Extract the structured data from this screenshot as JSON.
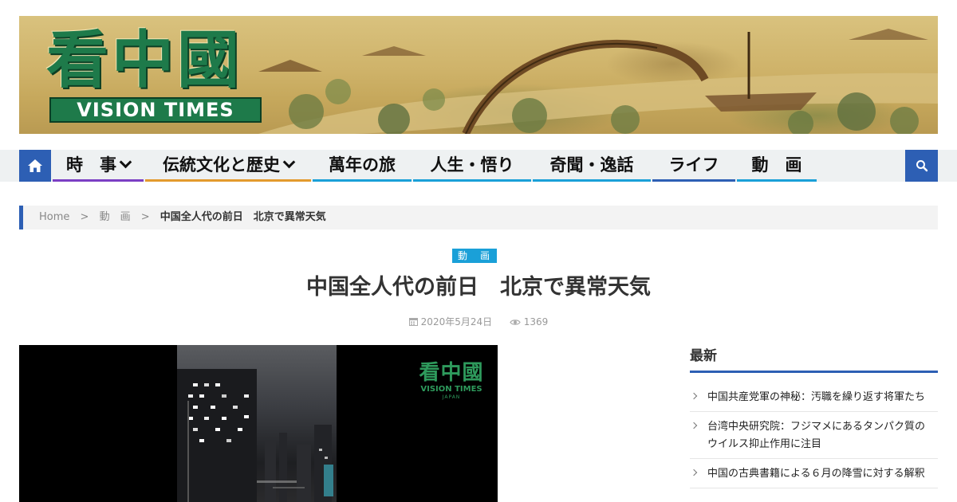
{
  "header": {
    "logo_cn": "看中國",
    "logo_en": "VISION TIMES"
  },
  "nav": {
    "home_icon": "home-icon",
    "search_icon": "search-icon",
    "accent": "#2d5fb4",
    "items": [
      {
        "label": "時　事",
        "dropdown": true,
        "underline": "#7b3fc4"
      },
      {
        "label": "伝統文化と歴史",
        "dropdown": true,
        "underline": "#e39a2d"
      },
      {
        "label": "萬年の旅",
        "dropdown": false,
        "underline": "#1aa0d8"
      },
      {
        "label": "人生・悟り",
        "dropdown": false,
        "underline": "#1aa0d8"
      },
      {
        "label": "奇聞・逸話",
        "dropdown": false,
        "underline": "#1aa0d8"
      },
      {
        "label": "ライフ",
        "dropdown": false,
        "underline": "#2d5fb4"
      },
      {
        "label": "動　画",
        "dropdown": false,
        "underline": "#1aa0d8"
      }
    ]
  },
  "breadcrumb": {
    "home": "Home",
    "sep": ">",
    "category": "動　画",
    "current": "中国全人代の前日　北京で異常天気"
  },
  "article": {
    "category": "動　画",
    "category_color": "#1aa0d8",
    "title": "中国全人代の前日　北京で異常天気",
    "date": "2020年5月24日",
    "views": "1369",
    "date_icon": "calendar-icon",
    "views_icon": "eye-icon"
  },
  "video": {
    "watermark_cn": "看中國",
    "watermark_en": "VISION TIMES",
    "watermark_sub": "JAPAN"
  },
  "sidebar": {
    "title": "最新",
    "items": [
      "中国共産党軍の神秘：汚職を繰り返す将軍たち",
      "台湾中央研究院：フジマメにあるタンパク質のウイルス抑止作用に注目",
      "中国の古典書籍による６月の降雪に対する解釈"
    ]
  }
}
